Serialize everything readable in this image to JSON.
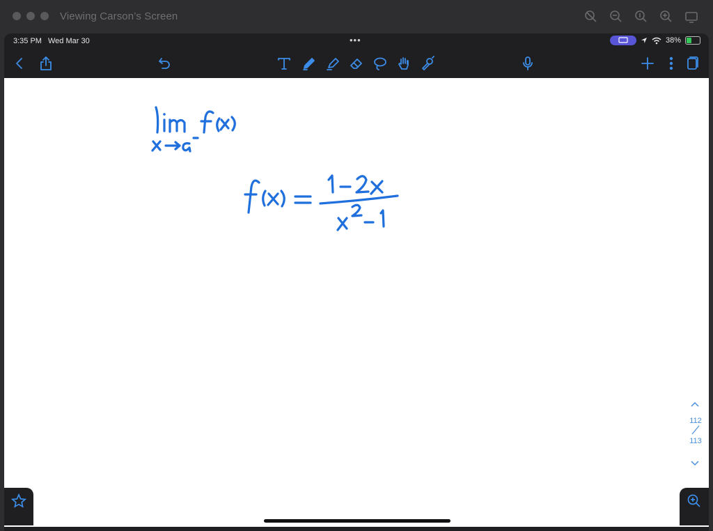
{
  "mac": {
    "window_title": "Viewing Carson’s Screen",
    "zoom_icons": [
      "zoom-fit-icon",
      "zoom-out-icon",
      "zoom-actual-icon",
      "zoom-in-icon",
      "screen-icon"
    ]
  },
  "status_bar": {
    "time": "3:35 PM",
    "date": "Wed Mar 30",
    "dots": "•••",
    "battery_pct": "38%",
    "battery_level": 0.38,
    "colors": {
      "screen_pill": "#5856d6",
      "battery": "#34c759"
    }
  },
  "toolbar": {
    "left": [
      "back-icon",
      "share-icon",
      "undo-icon"
    ],
    "tools": [
      "text-tool-icon",
      "pen-tool-icon",
      "highlighter-icon",
      "eraser-icon",
      "lasso-icon",
      "hand-icon",
      "laser-pointer-icon"
    ],
    "right": [
      "microphone-icon",
      "add-icon",
      "more-icon",
      "pages-icon"
    ],
    "accent": "#3c8de8"
  },
  "canvas": {
    "ink_color": "#1f6fdc",
    "notes": [
      "lim f(x)",
      "x→a⁻",
      "f(x) = (1−2x)/(x²−1)"
    ]
  },
  "pager": {
    "current": "112",
    "separator": "/",
    "total": "113"
  }
}
